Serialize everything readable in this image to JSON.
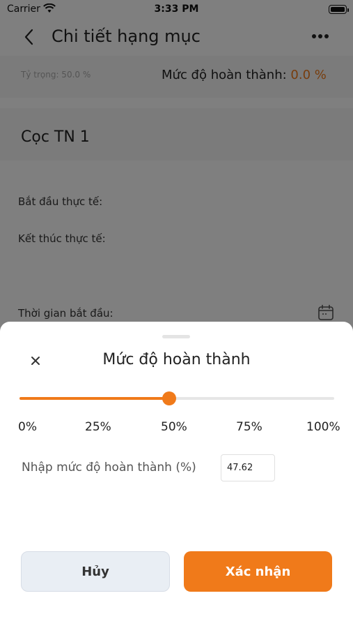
{
  "status_bar": {
    "carrier": "Carrier",
    "time": "3:33 PM"
  },
  "header": {
    "title": "Chi tiết hạng mục",
    "back_icon": "chevron-left-icon",
    "more_icon": "ellipsis-icon"
  },
  "summary": {
    "weight_text": "Tỷ trọng: 50.0 %",
    "progress_label": "Mức độ hoàn thành: ",
    "progress_value": "0.0 %"
  },
  "item": {
    "title": "Cọc TN 1"
  },
  "dates": {
    "actual_start_label": "Bắt đầu thực tế:",
    "actual_end_label": "Kết thúc thực tế:",
    "planned_start_label": "Thời gian bắt đầu:"
  },
  "sheet": {
    "title": "Mức độ hoàn thành",
    "slider": {
      "value": 47.62,
      "min": 0,
      "max": 100
    },
    "ticks": [
      "0%",
      "25%",
      "50%",
      "75%",
      "100%"
    ],
    "input_label": "Nhập mức độ hoàn thành (%)",
    "input_value": "47.62",
    "cancel_label": "Hủy",
    "confirm_label": "Xác nhận"
  },
  "colors": {
    "accent": "#f07a1a",
    "overlay": "rgba(0,0,0,0.5)"
  }
}
